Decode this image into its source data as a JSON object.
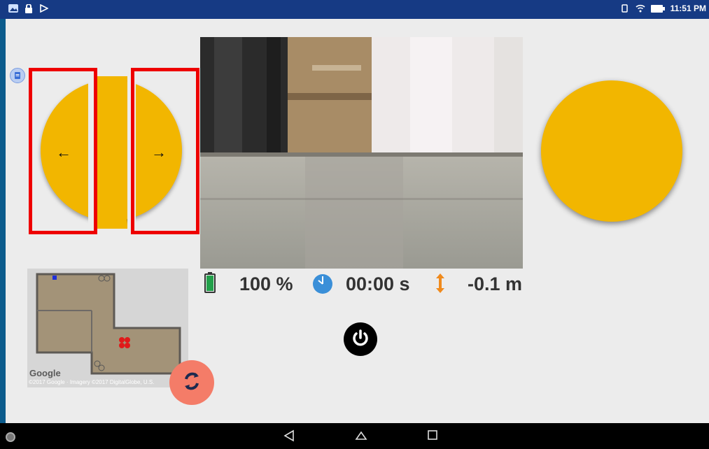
{
  "status_bar": {
    "time": "11:51 PM",
    "left_icons": [
      "gallery-icon",
      "lock-icon",
      "play-store-icon"
    ],
    "right_icons": [
      "sync-icon",
      "wifi-icon",
      "battery-icon"
    ]
  },
  "joystick": {
    "left_arrow": "←",
    "right_arrow": "→"
  },
  "stats": {
    "battery": "100 %",
    "timer": "00:00 s",
    "altitude": "-0.1 m",
    "battery_level": 1.0
  },
  "map": {
    "logo": "Google",
    "credit": "©2017 Google · Imagery ©2017 DigitalGlobe, U.S."
  },
  "colors": {
    "accent_yellow": "#f2b600",
    "status_bar": "#163a84",
    "refresh_button": "#f47c68",
    "highlight_red": "#ee0000",
    "battery_green": "#22a04a",
    "clock_blue": "#3a8fd8",
    "altitude_orange": "#f08a1c"
  },
  "icons": {
    "battery": "battery-icon",
    "timer": "clock-icon",
    "altitude": "vertical-arrows-icon",
    "power": "power-icon",
    "refresh": "refresh-icon",
    "small_fab": "document-icon"
  }
}
